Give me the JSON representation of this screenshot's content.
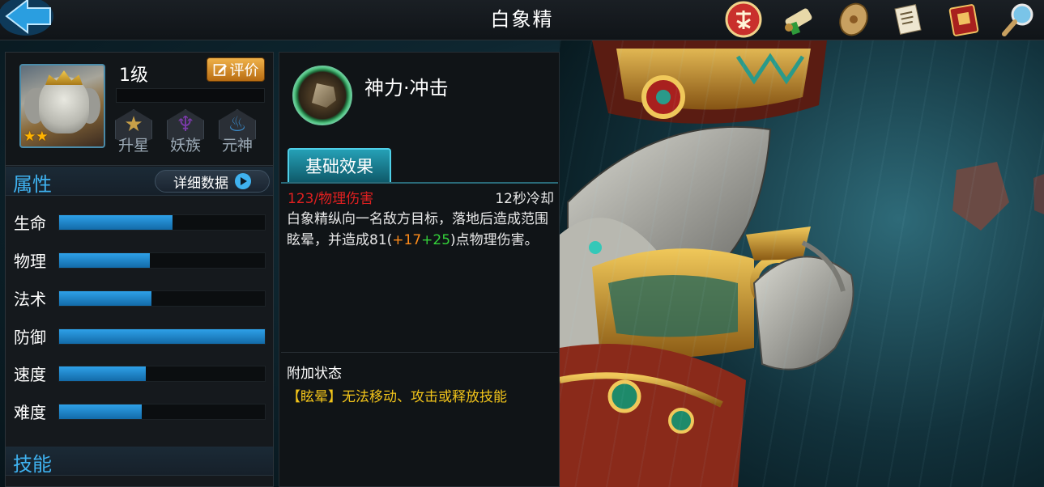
{
  "header": {
    "title": "白象精",
    "icons": [
      "back-arrow-icon",
      "battle-seal-icon",
      "scroll-icon",
      "shield-icon",
      "document-icon",
      "book-icon",
      "magnifier-icon"
    ]
  },
  "hero": {
    "level": "1级",
    "stars": "★★",
    "rate_label": "评价",
    "sub_buttons": [
      {
        "label": "升星",
        "icon": "star-icon"
      },
      {
        "label": "妖族",
        "icon": "demon-tribe-icon"
      },
      {
        "label": "元神",
        "icon": "spirit-flame-icon"
      }
    ]
  },
  "attributes": {
    "title": "属性",
    "detail_label": "详细数据",
    "stats": [
      {
        "name": "生命",
        "value": 0.55
      },
      {
        "name": "物理",
        "value": 0.44
      },
      {
        "name": "法术",
        "value": 0.45
      },
      {
        "name": "防御",
        "value": 1.0
      },
      {
        "name": "速度",
        "value": 0.42
      },
      {
        "name": "难度",
        "value": 0.4
      }
    ]
  },
  "skills_section": {
    "title": "技能"
  },
  "skill": {
    "name": "神力·冲击",
    "tab_label": "基础效果",
    "damage": "123/物理伤害",
    "cooldown": "12秒冷却",
    "desc_part1": "白象精纵向一名敌方目标，落地后造成范围眩晕，并造成81(",
    "desc_orange": "+17",
    "desc_green": "+25",
    "desc_part2": ")点物理伤害。",
    "additional_title": "附加状态",
    "additional_desc": "【眩晕】无法移动、攻击或释放技能"
  },
  "colors": {
    "accent_blue": "#3fb2f0",
    "damage_red": "#e02020",
    "status_yellow": "#f2c41a",
    "bonus_orange": "#ff8c1a",
    "bonus_green": "#34d23a"
  }
}
